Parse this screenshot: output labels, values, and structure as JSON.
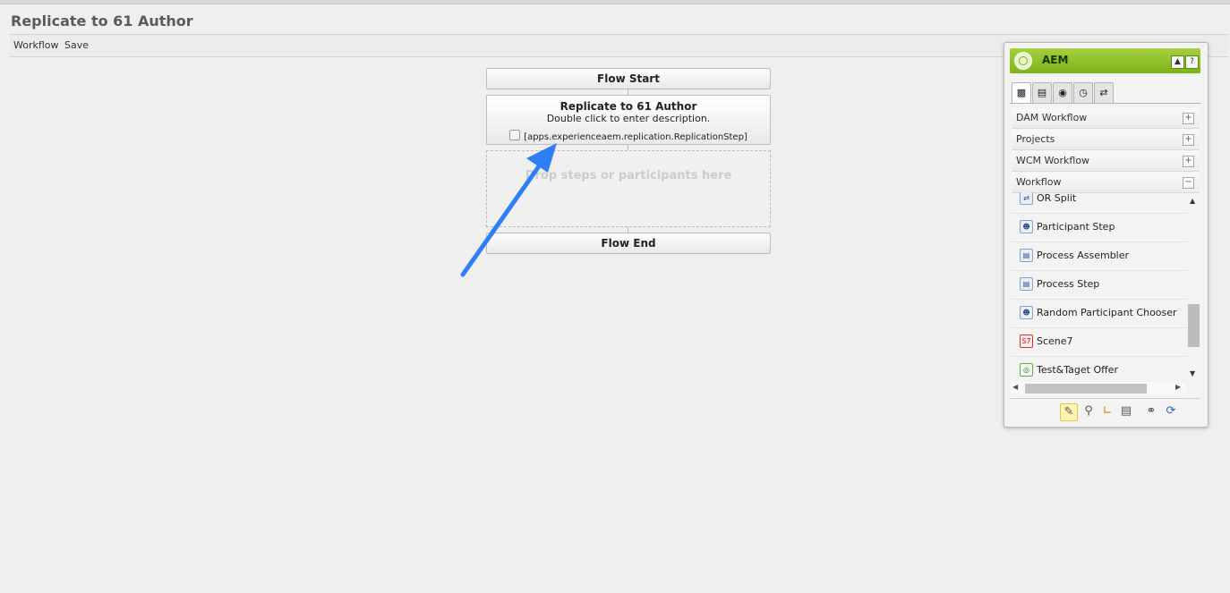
{
  "page": {
    "title": "Replicate to 61 Author"
  },
  "toolbar": {
    "workflow": "Workflow",
    "save": "Save"
  },
  "canvas": {
    "flow_start": "Flow Start",
    "step": {
      "title": "Replicate to 61 Author",
      "description": "Double click to enter description.",
      "class": "[apps.experienceaem.replication.ReplicationStep]"
    },
    "dropzone": "Drop steps or participants here",
    "flow_end": "Flow End"
  },
  "sidekick": {
    "title": "AEM",
    "header_buttons": [
      "▲",
      "?"
    ],
    "tabs": [
      {
        "icon": "components-icon"
      },
      {
        "icon": "page-icon"
      },
      {
        "icon": "lock-icon"
      },
      {
        "icon": "clock-icon"
      },
      {
        "icon": "workflow-icon"
      }
    ],
    "groups": [
      {
        "label": "DAM Workflow",
        "toggle": "+"
      },
      {
        "label": "Projects",
        "toggle": "+"
      },
      {
        "label": "WCM Workflow",
        "toggle": "+"
      },
      {
        "label": "Workflow",
        "toggle": "−"
      }
    ],
    "items": [
      {
        "label": "OR Split",
        "icon": "split-icon"
      },
      {
        "label": "Participant Step",
        "icon": "participant-icon"
      },
      {
        "label": "Process Assembler",
        "icon": "process-icon"
      },
      {
        "label": "Process Step",
        "icon": "process-icon"
      },
      {
        "label": "Random Participant Chooser",
        "icon": "participant-icon"
      },
      {
        "label": "Scene7",
        "icon": "scene7-icon"
      },
      {
        "label": "Test&Taget Offer",
        "icon": "target-icon"
      }
    ],
    "footer": [
      "pencil-icon",
      "search-icon",
      "ruler-icon",
      "page-icon",
      "link-icon",
      "refresh-icon"
    ]
  }
}
